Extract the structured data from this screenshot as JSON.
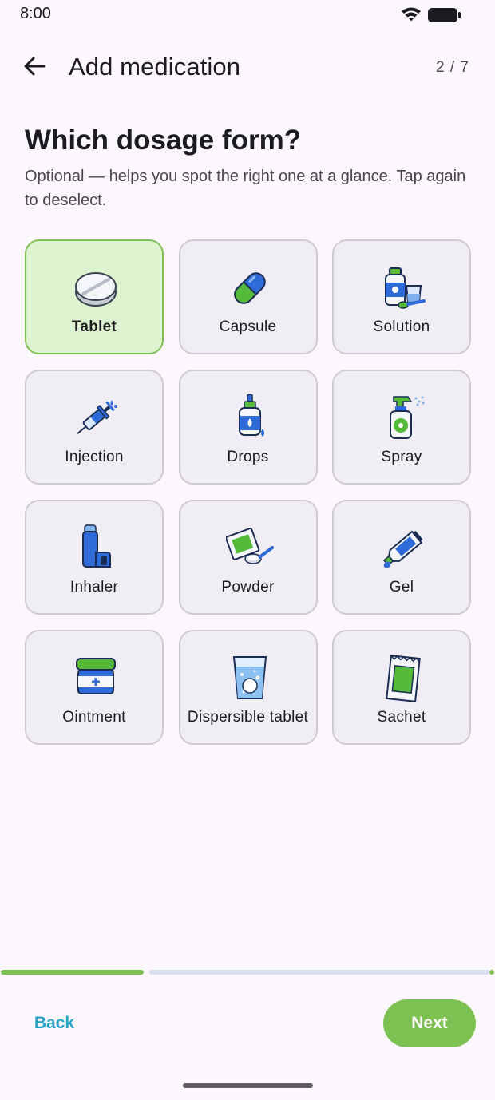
{
  "status_bar": {
    "time": "8:00"
  },
  "header": {
    "title": "Add medication",
    "step": "2 / 7"
  },
  "question": {
    "title": "Which dosage form?",
    "helper": "Optional — helps you spot the right one at a glance. Tap again to deselect."
  },
  "forms": [
    {
      "label": "Tablet",
      "icon": "tablet-icon",
      "selected": true
    },
    {
      "label": "Capsule",
      "icon": "capsule-icon",
      "selected": false
    },
    {
      "label": "Solution",
      "icon": "solution-icon",
      "selected": false
    },
    {
      "label": "Injection",
      "icon": "syringe-icon",
      "selected": false
    },
    {
      "label": "Drops",
      "icon": "dropper-bottle-icon",
      "selected": false
    },
    {
      "label": "Spray",
      "icon": "spray-bottle-icon",
      "selected": false
    },
    {
      "label": "Inhaler",
      "icon": "inhaler-icon",
      "selected": false
    },
    {
      "label": "Powder",
      "icon": "powder-icon",
      "selected": false
    },
    {
      "label": "Gel",
      "icon": "gel-tube-icon",
      "selected": false
    },
    {
      "label": "Ointment",
      "icon": "ointment-jar-icon",
      "selected": false
    },
    {
      "label": "Dispersible tablet",
      "icon": "dispersible-glass-icon",
      "selected": false
    },
    {
      "label": "Sachet",
      "icon": "sachet-icon",
      "selected": false
    }
  ],
  "progress": {
    "step": 2,
    "total": 7
  },
  "footer": {
    "back_label": "Back",
    "next_label": "Next"
  },
  "colors": {
    "accent": "#7cc152",
    "selected_tile": "#ddf3cf",
    "link": "#29a3c8",
    "tile": "#f1edf4",
    "background": "#fcf7fc"
  }
}
